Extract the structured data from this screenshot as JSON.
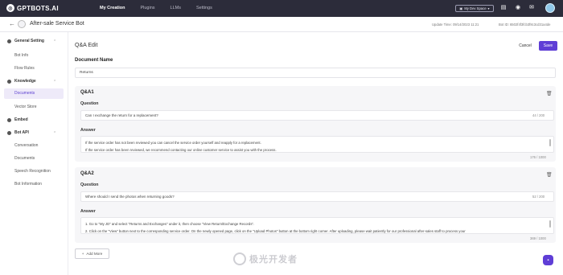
{
  "topbar": {
    "logo": "GPTBOTS.AI",
    "nav": [
      "My Creation",
      "Plugins",
      "LLMs",
      "Settings"
    ],
    "space_button": "My Dev Space"
  },
  "subbar": {
    "bot_name": "After-sale Service Bot",
    "update_time": "Update Time: 09/14/2023 11:21",
    "bot_id": "Bot ID:  6502f4f3fcb3f8c3cd31a4de"
  },
  "sidebar": {
    "general_setting": "General Setting",
    "bot_info": "Bot Info",
    "flow_rules": "Flow Rules",
    "knowledge": "Knowledge",
    "documents": "Documents",
    "vector_store": "Vector Store",
    "embed": "Embed",
    "bot_api": "Bot API",
    "conversation": "Conversation",
    "api_documents": "Documents",
    "speech_recognition": "Speech Recognition",
    "bot_information": "Bot Information"
  },
  "main": {
    "title": "Q&A Edit",
    "cancel": "Cancel",
    "save": "Save",
    "doc_name_label": "Document Name",
    "doc_name_value": "Returns",
    "question_label": "Question",
    "answer_label": "Answer",
    "add_more": "Add More",
    "qa": [
      {
        "title": "Q&A1",
        "question": "Can I exchange the return for a replacement?",
        "question_count": "44 / 200",
        "answer_lines": [
          "If the service order has not been reviewed you can cancel the service order yourself and reapply for a replacement.",
          "If the service order has been reviewed, we recommend contacting our online customer service to assist you with the process."
        ],
        "answer_count": "176 / 1000"
      },
      {
        "title": "Q&A2",
        "question": "Where should I send the photos when returning goods?",
        "question_count": "52 / 200",
        "answer_lines": [
          "1. Go to \"My JD\" and select \"Returns and Exchanges\" under it, then choose \"View Return/Exchange Records\".",
          "2. Click on the \"View\" button next to the corresponding service order. On the newly opened page, click on the \"Upload Photos\" button at the bottom right corner. After uploading, please wait patiently for our professional after-sales staff to process your"
        ],
        "answer_count": "369 / 1000"
      }
    ]
  },
  "watermark": "极光开发者"
}
